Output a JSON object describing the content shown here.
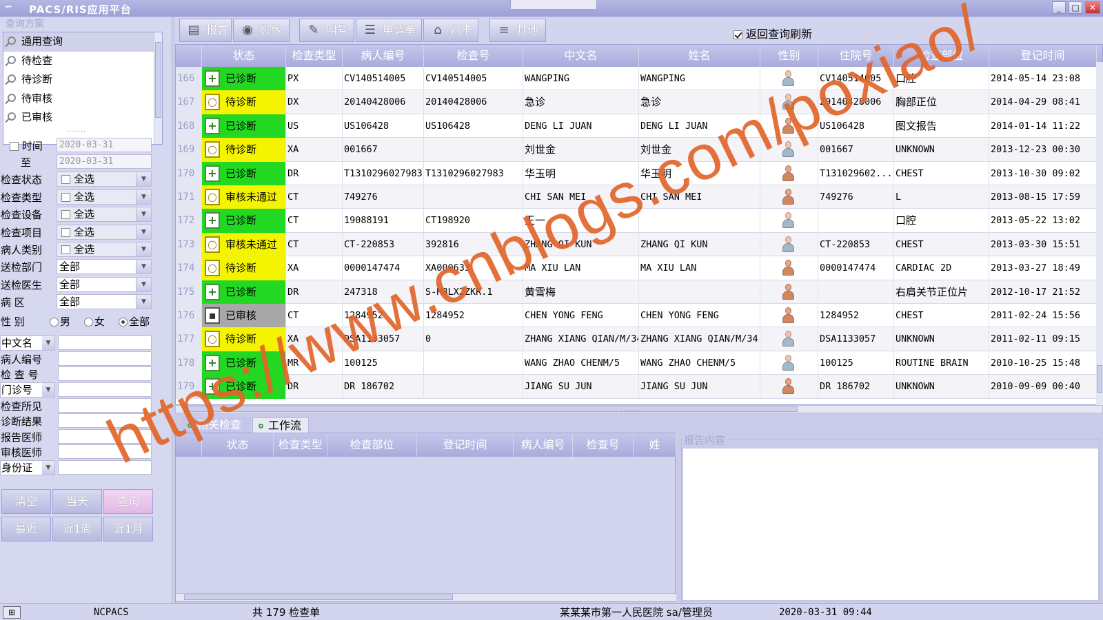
{
  "app": {
    "logo": "∽",
    "title": "PACS/RIS应用平台"
  },
  "scheme": {
    "legend": "查询方案",
    "items": [
      "通用查询",
      "待检查",
      "待诊断",
      "待审核",
      "已审核"
    ]
  },
  "filters": {
    "time_label": "时间",
    "to_label": "至",
    "date_from": "2020-03-31",
    "date_to": "2020-03-31",
    "select_all": "全选",
    "all": "全部",
    "status_label": "检查状态",
    "type_label": "检查类型",
    "device_label": "检查设备",
    "item_label": "检查项目",
    "patient_cat_label": "病人类别",
    "send_dept_label": "送检部门",
    "send_doctor_label": "送检医生",
    "ward_label": "病 区",
    "gender_label": "性 别",
    "gender_male": "男",
    "gender_female": "女",
    "gender_all": "全部",
    "chinese_name_label": "中文名",
    "patient_no_label": "病人编号",
    "exam_no_label": "检 查 号",
    "outpatient_label": "门诊号",
    "findings_label": "检查所见",
    "diagnosis_label": "诊断结果",
    "report_doctor_label": "报告医师",
    "audit_doctor_label": "审核医师",
    "id_card_label": "身份证"
  },
  "quick_buttons": {
    "clear": "清空",
    "today": "当天",
    "query": "查询",
    "recent": "最近",
    "week": "近1周",
    "month": "近1月"
  },
  "toolbar": {
    "report": "报告",
    "image": "影像",
    "call": "叫号",
    "request": "申请单",
    "card": "刷卡",
    "other": "其他",
    "refresh_label": "返回查询刷新"
  },
  "grid": {
    "columns": [
      "状态",
      "检查类型",
      "病人编号",
      "检查号",
      "中文名",
      "姓名",
      "性别",
      "住院号",
      "检查部位",
      "登记时间"
    ],
    "rows": [
      {
        "n": "166",
        "status": "已诊断",
        "c": "green",
        "type": "PX",
        "pid": "CV140514005",
        "eno": "CV140514005",
        "cn": "WANGPING",
        "name": "WANGPING",
        "g": "m",
        "inp": "CV140514005",
        "part": "口腔",
        "time": "2014-05-14 23:08"
      },
      {
        "n": "167",
        "status": "待诊断",
        "c": "yellow",
        "type": "DX",
        "pid": "20140428006",
        "eno": "20140428006",
        "cn": "急诊",
        "name": "急诊",
        "g": "m",
        "inp": "20140428006",
        "part": "胸部正位",
        "time": "2014-04-29 08:41"
      },
      {
        "n": "168",
        "status": "已诊断",
        "c": "green",
        "type": "US",
        "pid": "US106428",
        "eno": "US106428",
        "cn": "DENG LI JUAN",
        "name": "DENG LI JUAN",
        "g": "f",
        "inp": "US106428",
        "part": "图文报告",
        "time": "2014-01-14 11:22"
      },
      {
        "n": "169",
        "status": "待诊断",
        "c": "yellow",
        "type": "XA",
        "pid": "001667",
        "eno": "",
        "cn": "刘世金",
        "name": "刘世金",
        "g": "m",
        "inp": "001667",
        "part": "UNKNOWN",
        "time": "2013-12-23 00:30"
      },
      {
        "n": "170",
        "status": "已诊断",
        "c": "green",
        "type": "DR",
        "pid": "T1310296027983",
        "eno": "T1310296027983",
        "cn": "华玉明",
        "name": "华玉明",
        "g": "f",
        "inp": "T131029602...",
        "part": "CHEST",
        "time": "2013-10-30 09:02"
      },
      {
        "n": "171",
        "status": "审核未通过",
        "c": "yellow",
        "type": "CT",
        "pid": "749276",
        "eno": "",
        "cn": "CHI SAN MEI",
        "name": "CHI SAN MEI",
        "g": "f",
        "inp": "749276",
        "part": "L",
        "time": "2013-08-15 17:59"
      },
      {
        "n": "172",
        "status": "已诊断",
        "c": "green",
        "type": "CT",
        "pid": "19088191",
        "eno": "CT198920",
        "cn": "王一",
        "name": "",
        "g": "m",
        "inp": "",
        "part": "口腔",
        "time": "2013-05-22 13:02"
      },
      {
        "n": "173",
        "status": "审核未通过",
        "c": "yellow",
        "type": "CT",
        "pid": "CT-220853",
        "eno": "392816",
        "cn": "ZHANG QI KUN",
        "name": "ZHANG QI KUN",
        "g": "m",
        "inp": "CT-220853",
        "part": "CHEST",
        "time": "2013-03-30 15:51"
      },
      {
        "n": "174",
        "status": "待诊断",
        "c": "yellow",
        "type": "XA",
        "pid": "0000147474",
        "eno": "XA000633",
        "cn": "MA XIU LAN",
        "name": "MA XIU LAN",
        "g": "f",
        "inp": "0000147474",
        "part": "CARDIAC 2D",
        "time": "2013-03-27 18:49"
      },
      {
        "n": "175",
        "status": "已诊断",
        "c": "green",
        "type": "DR",
        "pid": "247318",
        "eno": "S-H8LX2ZKR.1",
        "cn": "黄雪梅",
        "name": "",
        "g": "f",
        "inp": "",
        "part": "右肩关节正位片",
        "time": "2012-10-17 21:52"
      },
      {
        "n": "176",
        "status": "已审核",
        "c": "gray",
        "type": "CT",
        "pid": "1284952",
        "eno": "1284952",
        "cn": "CHEN YONG FENG",
        "name": "CHEN YONG FENG",
        "g": "f",
        "inp": "1284952",
        "part": "CHEST",
        "time": "2011-02-24 15:56"
      },
      {
        "n": "177",
        "status": "待诊断",
        "c": "yellow",
        "type": "XA",
        "pid": "DSA1133057",
        "eno": "0",
        "cn": "ZHANG XIANG QIAN/M/34",
        "name": "ZHANG XIANG QIAN/M/34",
        "g": "m",
        "inp": "DSA1133057",
        "part": "UNKNOWN",
        "time": "2011-02-11 09:15"
      },
      {
        "n": "178",
        "status": "已诊断",
        "c": "green",
        "type": "MR",
        "pid": "100125",
        "eno": "",
        "cn": "WANG ZHAO CHENM/5",
        "name": "WANG ZHAO CHENM/5",
        "g": "m",
        "inp": "100125",
        "part": "ROUTINE BRAIN",
        "time": "2010-10-25 15:48"
      },
      {
        "n": "179",
        "status": "已诊断",
        "c": "green",
        "type": "DR",
        "pid": "DR 186702",
        "eno": "",
        "cn": "JIANG SU JUN",
        "name": "JIANG SU JUN",
        "g": "f",
        "inp": "DR 186702",
        "part": "UNKNOWN",
        "time": "2010-09-09 00:40"
      }
    ]
  },
  "bottom_tabs": [
    "相关检查",
    "工作流"
  ],
  "sub_columns": [
    "状态",
    "检查类型",
    "检查部位",
    "登记时间",
    "病人编号",
    "检查号",
    "姓"
  ],
  "report": {
    "legend": "报告内容"
  },
  "statusbar": {
    "app": "NCPACS",
    "count": "共 179 检查单",
    "hospital": "某某某市第一人民医院 sa/管理员",
    "datetime": "2020-03-31 09:44"
  },
  "watermark": "https://www.cnblogs.com/poxiao/",
  "colors": {
    "green": "#22d822",
    "yellow": "#f4f400",
    "gray": "#a8a8a8",
    "watermark": "#e2652a"
  }
}
